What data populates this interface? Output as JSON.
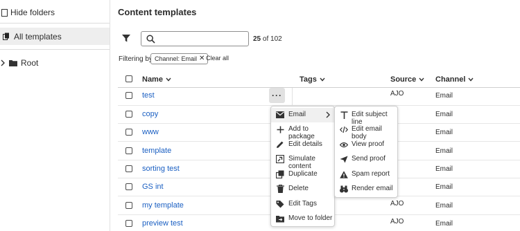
{
  "sidebar": {
    "hide_folders": "Hide folders",
    "all_templates": "All templates",
    "root": "Root"
  },
  "header": {
    "title": "Content templates",
    "search_placeholder": "",
    "count_bold": "25",
    "count_rest": " of 102"
  },
  "filters": {
    "label": "Filtering by",
    "chip": "Channel: Email",
    "clear_all": "Clear all"
  },
  "table": {
    "columns": [
      "Name",
      "Tags",
      "Source",
      "Channel"
    ],
    "rows": [
      {
        "name": "test",
        "source": "AJO",
        "channel": "Email"
      },
      {
        "name": "copy",
        "source": "",
        "channel": "Email"
      },
      {
        "name": "www",
        "source": "",
        "channel": "Email"
      },
      {
        "name": "template",
        "source": "",
        "channel": "Email"
      },
      {
        "name": "sorting test",
        "source": "",
        "channel": "Email"
      },
      {
        "name": "GS int",
        "source": "",
        "channel": "Email"
      },
      {
        "name": "my template",
        "source": "AJO",
        "channel": "Email"
      },
      {
        "name": "preview test",
        "source": "AJO",
        "channel": "Email"
      }
    ],
    "more_label": "···"
  },
  "context_menu": {
    "items": [
      {
        "label": "Email",
        "icon": "email-icon"
      },
      {
        "label": "Add to package",
        "icon": "plus-icon"
      },
      {
        "label": "Edit details",
        "icon": "pencil-icon"
      },
      {
        "label": "Simulate content",
        "icon": "simulate-icon"
      },
      {
        "label": "Duplicate",
        "icon": "duplicate-icon"
      },
      {
        "label": "Delete",
        "icon": "trash-icon"
      },
      {
        "label": "Edit Tags",
        "icon": "tag-icon"
      },
      {
        "label": "Move to folder",
        "icon": "move-folder-icon"
      }
    ]
  },
  "submenu": {
    "items": [
      {
        "label": "Edit subject line",
        "icon": "text-icon"
      },
      {
        "label": "Edit email body",
        "icon": "code-icon"
      },
      {
        "label": "View proof",
        "icon": "eye-icon"
      },
      {
        "label": "Send proof",
        "icon": "send-icon"
      },
      {
        "label": "Spam report",
        "icon": "alert-icon"
      },
      {
        "label": "Render email",
        "icon": "binoculars-icon"
      }
    ]
  },
  "colors": {
    "link": "#1a5fc2",
    "menu_active": "#f0f0f0"
  }
}
